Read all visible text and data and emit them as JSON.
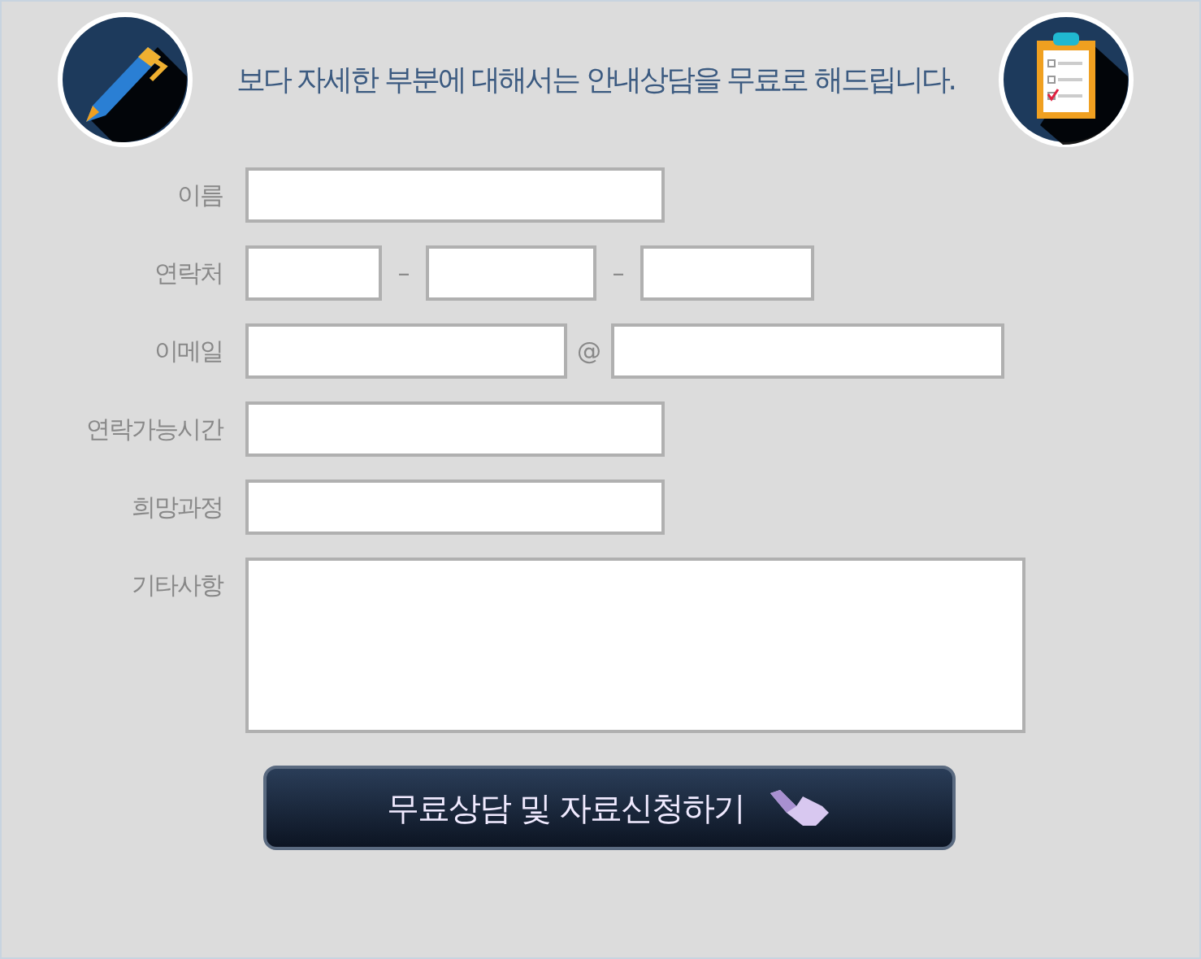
{
  "header": {
    "text": "보다 자세한 부분에 대해서는 안내상담을 무료로 해드립니다."
  },
  "fields": [
    {
      "kind": "text",
      "label": "이름"
    },
    {
      "kind": "phone",
      "label": "연락처",
      "separators": [
        "–",
        "–"
      ]
    },
    {
      "kind": "email",
      "label": "이메일",
      "separators": [
        "@"
      ]
    },
    {
      "kind": "text",
      "label": "연락가능시간"
    },
    {
      "kind": "text",
      "label": "희망과정"
    },
    {
      "kind": "textarea",
      "label": "기타사항"
    }
  ],
  "submit": {
    "label": "무료상담 및 자료신청하기"
  }
}
